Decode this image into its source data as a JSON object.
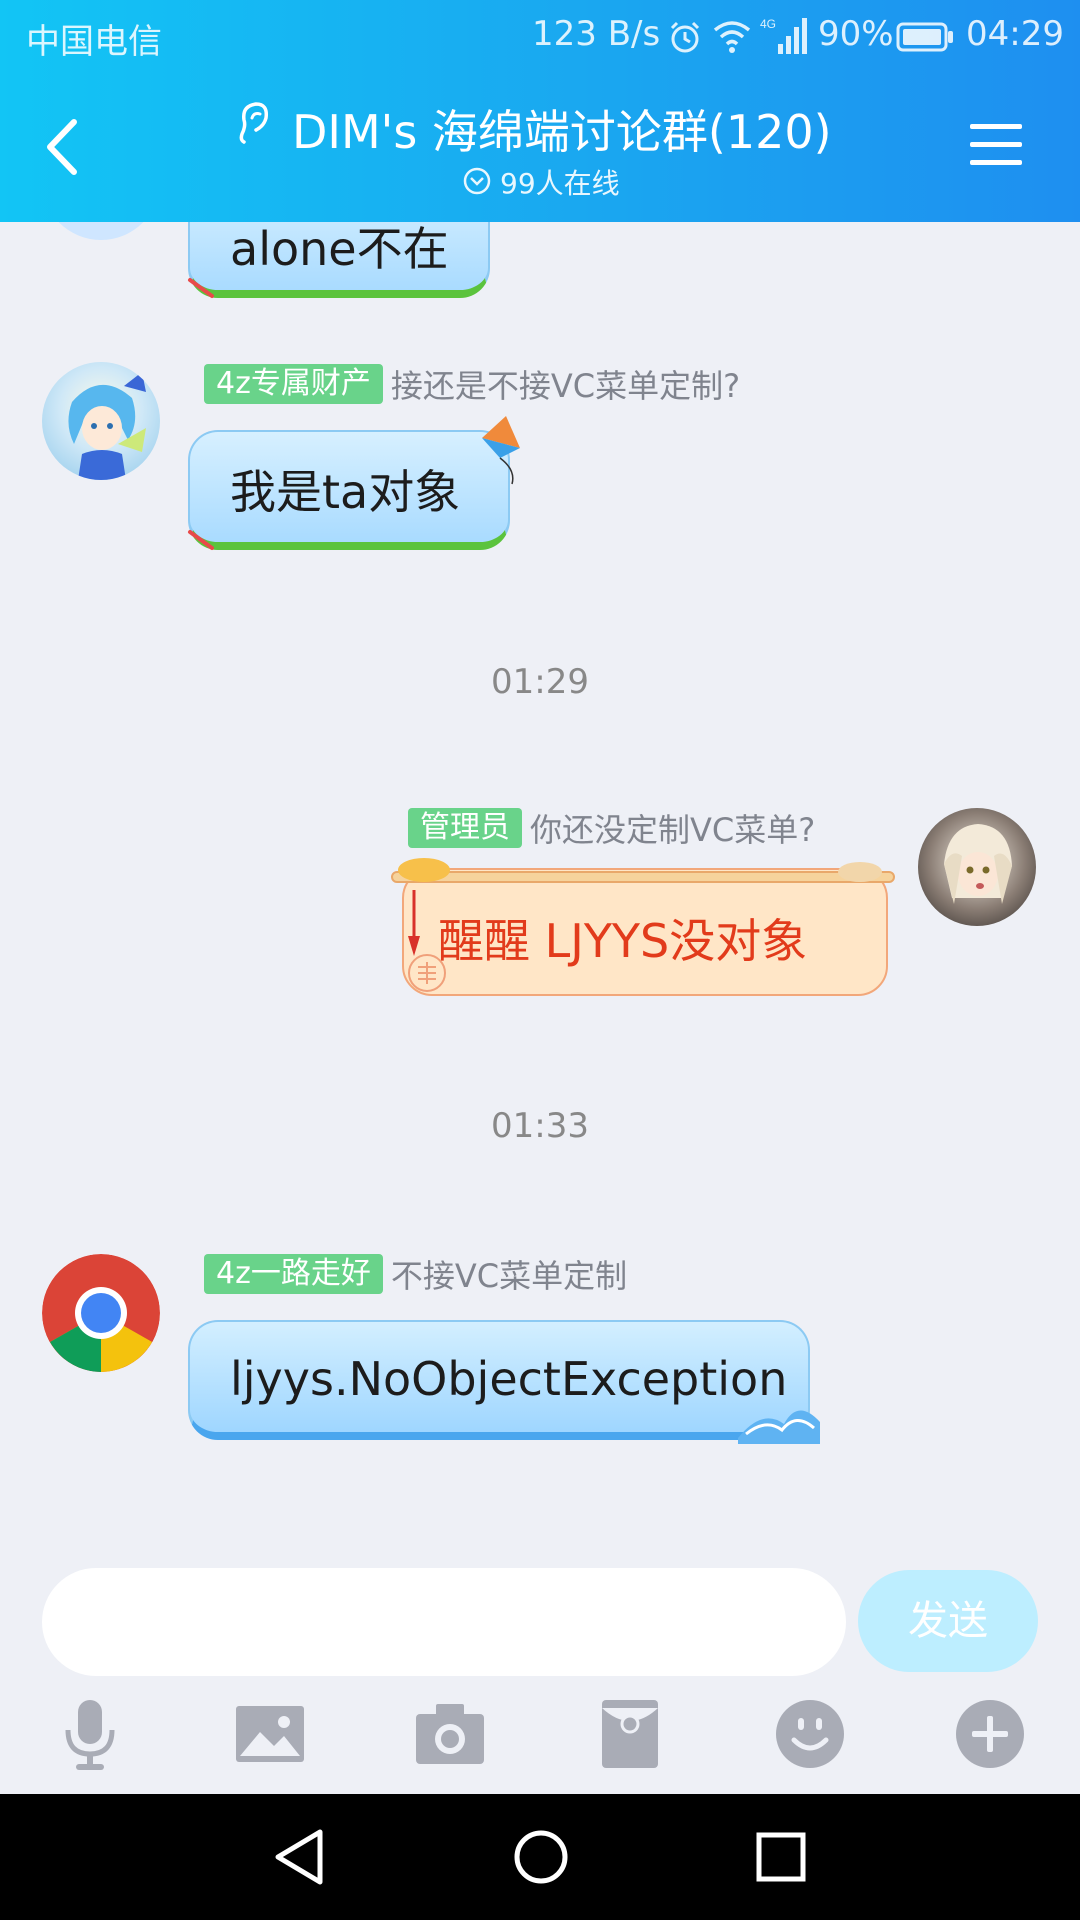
{
  "status_bar": {
    "carrier": "中国电信",
    "network_speed": "123 B/s",
    "battery_percent": "90%",
    "time": "04:29",
    "signal_type": "4G"
  },
  "header": {
    "title": "DIM's 海绵端讨论群(120)",
    "online_status": "99人在线"
  },
  "messages": [
    {
      "text": "alone不在"
    },
    {
      "badge": "4z专属财产",
      "nickname": "接还是不接VC菜单定制?",
      "text": "我是ta对象"
    },
    {
      "badge": "管理员",
      "nickname": "你还没定制VC菜单?",
      "text": "醒醒 LJYYS没对象"
    },
    {
      "badge": "4z一路走好",
      "nickname": "不接VC菜单定制",
      "text": "ljyys.NoObjectException"
    }
  ],
  "timestamps": [
    "01:29",
    "01:33"
  ],
  "input": {
    "placeholder": "",
    "send_label": "发送"
  },
  "colors": {
    "header_start": "#12c5f5",
    "header_end": "#1e8ff0",
    "badge_green": "#69d38a",
    "admin_text": "#e23b1b",
    "send_button": "#bdeeff"
  },
  "toolbar_icons": [
    "mic-icon",
    "image-icon",
    "camera-icon",
    "red-packet-icon",
    "emoji-icon",
    "plus-icon"
  ],
  "nav_icons": [
    "back-triangle-icon",
    "home-circle-icon",
    "recents-square-icon"
  ]
}
